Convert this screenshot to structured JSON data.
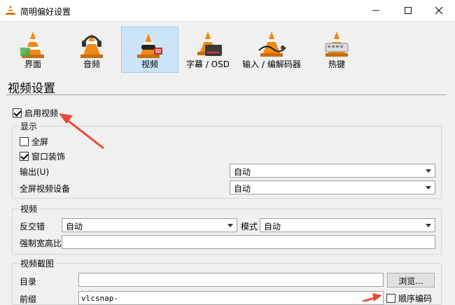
{
  "window": {
    "title": "简明偏好设置"
  },
  "toolbar": {
    "items": [
      {
        "label": "界面"
      },
      {
        "label": "音频"
      },
      {
        "label": "视频"
      },
      {
        "label": "字幕 / OSD"
      },
      {
        "label": "输入 / 编解码器"
      },
      {
        "label": "热键"
      }
    ],
    "active": "视频"
  },
  "section": {
    "title": "视频设置"
  },
  "enable_video": {
    "label": "启用视频",
    "checked": true
  },
  "display": {
    "group_label": "显示",
    "fullscreen": {
      "label": "全屏",
      "checked": false
    },
    "decorations": {
      "label": "窗口装饰",
      "checked": true
    },
    "output": {
      "label": "输出(U)",
      "value": "自动"
    },
    "fullscreen_device": {
      "label": "全屏视频设备",
      "value": "自动"
    }
  },
  "video": {
    "group_label": "视频",
    "deinterlace": {
      "label": "反交错",
      "value": "自动"
    },
    "mode": {
      "label": "模式",
      "value": "自动"
    },
    "aspect": {
      "label": "强制宽高比",
      "value": ""
    }
  },
  "snapshot": {
    "group_label": "视频截图",
    "directory": {
      "label": "目录",
      "value": ""
    },
    "browse_label": "浏览...",
    "prefix": {
      "label": "前缀",
      "value": "vlcsnap-"
    },
    "sequential": {
      "label": "顺序编码",
      "checked": false
    }
  },
  "colors": {
    "accent_active": "#cce4f7",
    "arrow": "#e8473b",
    "cone_orange": "#f08a12"
  }
}
